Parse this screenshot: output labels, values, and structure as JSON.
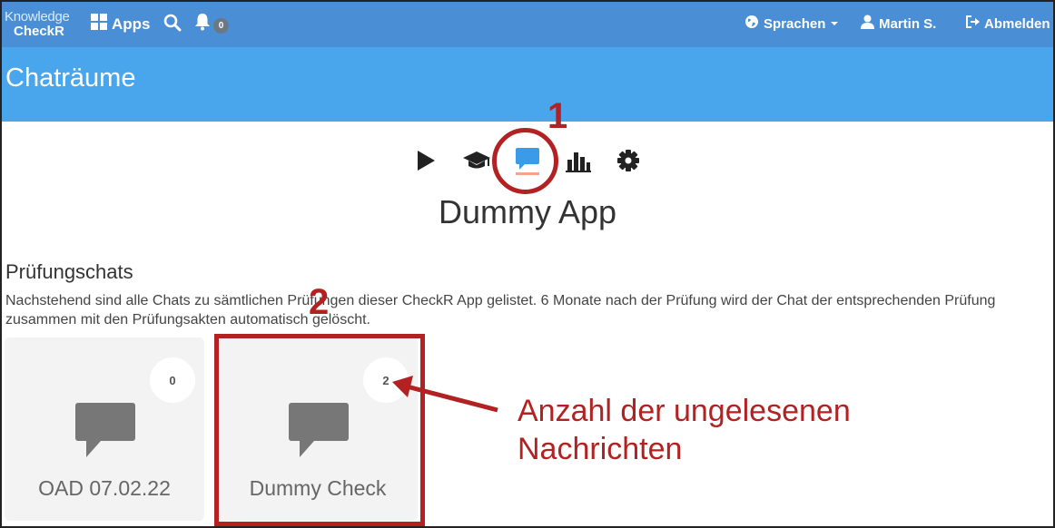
{
  "navbar": {
    "logo_line1": "Knowledge",
    "logo_line2": "CheckR",
    "apps_label": "Apps",
    "notification_count": "0",
    "language_label": "Sprachen",
    "user_label": "Martin S.",
    "logout_label": "Abmelden"
  },
  "page": {
    "title": "Chaträume"
  },
  "toolbar": {
    "icons": [
      "play-icon",
      "graduation-cap-icon",
      "chat-icon",
      "bar-chart-icon",
      "gear-icon"
    ],
    "active": "chat-icon"
  },
  "app_name": "Dummy App",
  "section": {
    "title": "Prüfungschats",
    "description": "Nachstehend sind alle Chats zu sämtlichen Prüfungen dieser CheckR App gelistet. 6 Monate nach der Prüfung wird der Chat der entsprechenden Prüfung zusammen mit den Prüfungsakten automatisch gelöscht."
  },
  "chats": [
    {
      "name": "OAD 07.02.22",
      "unread": "0"
    },
    {
      "name": "Dummy Check",
      "unread": "2"
    }
  ],
  "annotations": {
    "marker_1": "1",
    "marker_2": "2",
    "note_line1": "Anzahl der ungelesenen",
    "note_line2": "Nachrichten"
  },
  "colors": {
    "navbar": "#4a8fd6",
    "titlebar": "#4aa6ec",
    "active_icon": "#3a9be8",
    "annotation": "#b22222"
  }
}
